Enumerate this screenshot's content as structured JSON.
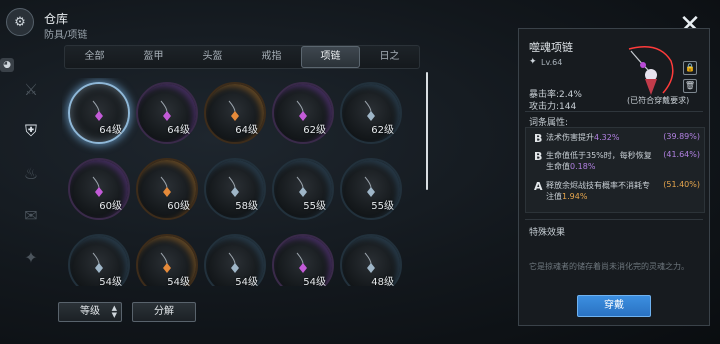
{
  "header": {
    "title": "仓库",
    "breadcrumb": "防具/项链",
    "logo_icon": "warehouse-icon"
  },
  "tabs": [
    {
      "label": "全部",
      "active": false
    },
    {
      "label": "盔甲",
      "active": false
    },
    {
      "label": "头盔",
      "active": false
    },
    {
      "label": "戒指",
      "active": false
    },
    {
      "label": "项链",
      "active": true
    },
    {
      "label": "日之",
      "active": false
    }
  ],
  "rail": [
    {
      "icon": "sword-icon",
      "active": false
    },
    {
      "icon": "armor-icon",
      "active": true
    },
    {
      "icon": "flame-icon",
      "active": false
    },
    {
      "icon": "scroll-icon",
      "active": false
    },
    {
      "icon": "pet-icon",
      "active": false
    }
  ],
  "items": [
    {
      "level": "64级",
      "rarity": "purple",
      "selected": true
    },
    {
      "level": "64级",
      "rarity": "purple",
      "selected": false
    },
    {
      "level": "64级",
      "rarity": "orange",
      "selected": false
    },
    {
      "level": "62级",
      "rarity": "purple",
      "selected": false
    },
    {
      "level": "62级",
      "rarity": "blue",
      "selected": false
    },
    {
      "level": "60级",
      "rarity": "purple",
      "selected": false
    },
    {
      "level": "60级",
      "rarity": "orange",
      "selected": false
    },
    {
      "level": "58级",
      "rarity": "blue",
      "selected": false
    },
    {
      "level": "55级",
      "rarity": "blue",
      "selected": false
    },
    {
      "level": "55级",
      "rarity": "blue",
      "selected": false
    },
    {
      "level": "54级",
      "rarity": "blue",
      "selected": false
    },
    {
      "level": "54级",
      "rarity": "orange",
      "selected": false
    },
    {
      "level": "54级",
      "rarity": "blue",
      "selected": false
    },
    {
      "level": "54级",
      "rarity": "purple",
      "selected": false
    },
    {
      "level": "48级",
      "rarity": "blue",
      "selected": false
    }
  ],
  "buttons": {
    "sort": "等级",
    "split": "分解"
  },
  "detail": {
    "name": "噬魂项链",
    "level": "Lv.64",
    "crit": "暴击率:2.4%",
    "attack": "攻击力:144",
    "requirement": "(已符合穿戴要求)",
    "attr_title": "词条属性:",
    "attrs": [
      {
        "grade": "B",
        "text": "法术伤害提升",
        "value": "4.32%",
        "range": "(39.89%)",
        "tone": "purple"
      },
      {
        "grade": "B",
        "text": "生命值低于35%时，每秒恢复生命值",
        "value": "0.18%",
        "range": "(41.64%)",
        "tone": "purple"
      },
      {
        "grade": "A",
        "text": "释放余烬战技有概率不消耗专注值",
        "value": "1.94%",
        "range": "(51.40%)",
        "tone": "gold"
      }
    ],
    "special_title": "特殊效果",
    "flavor": "它是掠魂者的储存着尚未消化完的灵魂之力。",
    "equip": "穿戴"
  },
  "colors": {
    "purple": "#b080e0",
    "gold": "#e6a64d",
    "accent": "#3c8fe0"
  }
}
